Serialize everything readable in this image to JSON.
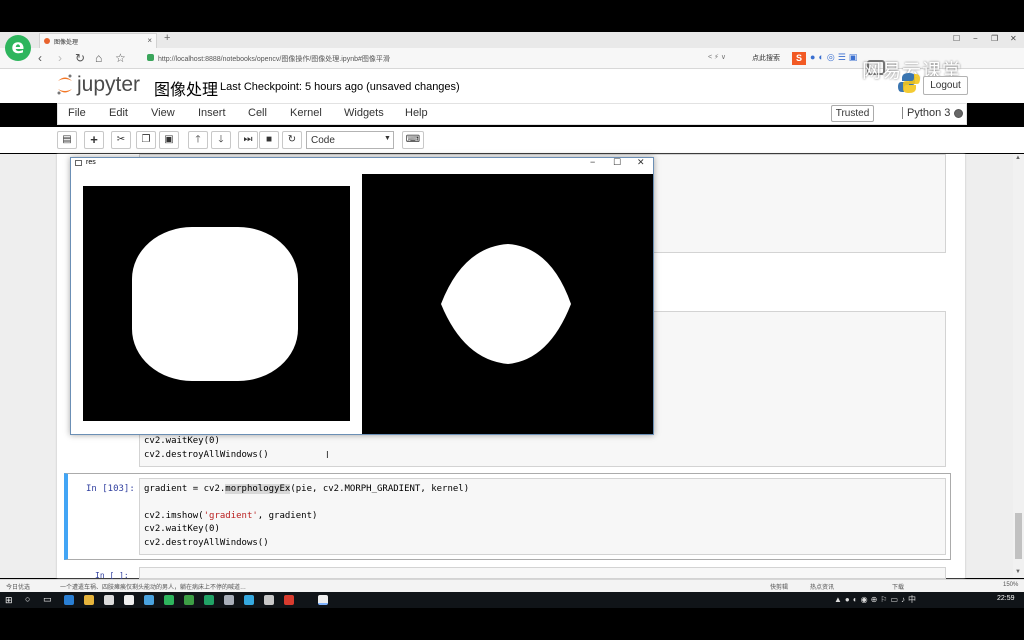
{
  "browser": {
    "tab_title": "图像处理",
    "new_tab_label": "+",
    "url": "http://localhost:8888/notebooks/opencv/图像操作/图像处理.ipynb#图像平滑",
    "url_right": "< ⚡ ∨",
    "search_engine_label": "点此搜索",
    "sogou_label": "S"
  },
  "watermark": {
    "text": "网易云课堂"
  },
  "jupyter": {
    "logo_text": "jupyter",
    "notebook_name": "图像处理",
    "checkpoint": "Last Checkpoint: 5 hours ago (unsaved changes)",
    "logout_label": "Logout",
    "menu": [
      "File",
      "Edit",
      "View",
      "Insert",
      "Cell",
      "Kernel",
      "Widgets",
      "Help"
    ],
    "trusted_label": "Trusted",
    "kernel_name": "Python 3",
    "toolbar_icons": [
      "save-icon",
      "plus-icon",
      "scissors-icon",
      "copy-icon",
      "paste-icon",
      "arrow-up-icon",
      "arrow-down-icon",
      "step-forward-icon",
      "stop-icon",
      "restart-icon",
      "keyboard-icon"
    ],
    "cell_type": "Code"
  },
  "cells": {
    "partial_lines": [
      "cv2.waitKey(0)",
      "cv2.destroyAllWindows()"
    ],
    "active": {
      "prompt": "In [103]:",
      "line1_pre": "gradient = cv2.",
      "line1_hl": "morphologyEx",
      "line1_post": "(pie, cv2.MORPH_GRADIENT, kernel)",
      "line3_pre": "cv2.imshow(",
      "line3_str": "'gradient'",
      "line3_post": ", gradient)",
      "line4": "cv2.waitKey(0)",
      "line5": "cv2.destroyAllWindows()"
    },
    "next_prompt": "In [ ]:"
  },
  "cv_window": {
    "title": "res"
  },
  "statusbar": {
    "left": "今日优选",
    "news": "一个遭遣车祸、四肢瘫痪仅剩头能动的男人，躺在病床上不停的喊道…",
    "right": [
      "快剪辑",
      "热点资讯",
      "下载"
    ],
    "zoom": "150%"
  },
  "taskbar": {
    "clock": "22:59"
  }
}
